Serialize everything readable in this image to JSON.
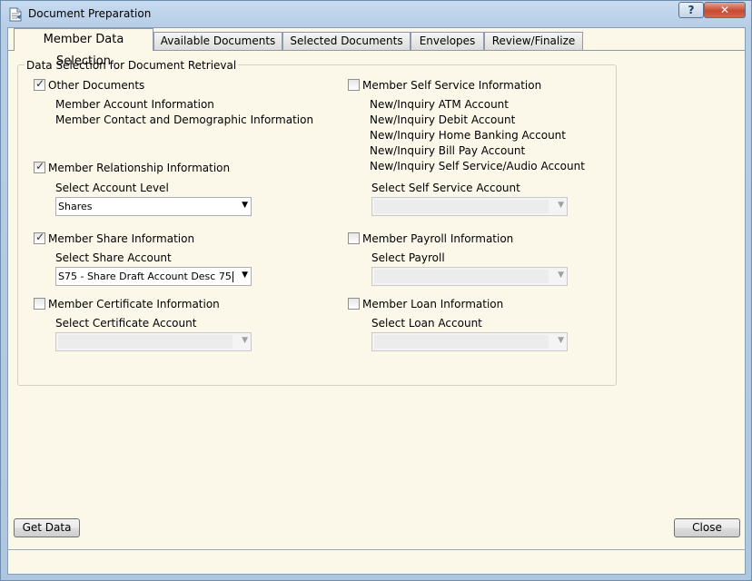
{
  "window": {
    "title": "Document Preparation",
    "help_label": "?",
    "close_label": "✕"
  },
  "tabs": [
    {
      "label": "Member Data Selection"
    },
    {
      "label": "Available Documents"
    },
    {
      "label": "Selected Documents"
    },
    {
      "label": "Envelopes"
    },
    {
      "label": "Review/Finalize"
    }
  ],
  "group": {
    "legend": "Data Selection for Document Retrieval",
    "other_documents": {
      "label": "Other Documents",
      "checked": true,
      "items": [
        "Member Account Information",
        "Member Contact and Demographic Information"
      ]
    },
    "relationship": {
      "label": "Member Relationship Information",
      "checked": true,
      "select_label": "Select Account Level",
      "select_value": "Shares"
    },
    "share": {
      "label": "Member Share Information",
      "checked": true,
      "select_label": "Select Share Account",
      "select_value": "S75 - Share Draft Account Desc 75"
    },
    "certificate": {
      "label": "Member Certificate Information",
      "checked": false,
      "select_label": "Select Certificate Account",
      "select_value": ""
    },
    "self_service": {
      "label": "Member Self Service Information",
      "checked": false,
      "items": [
        "New/Inquiry ATM Account",
        "New/Inquiry Debit Account",
        "New/Inquiry Home Banking Account",
        "New/Inquiry Bill Pay Account",
        "New/Inquiry Self Service/Audio Account"
      ],
      "select_label": "Select Self Service Account",
      "select_value": ""
    },
    "payroll": {
      "label": "Member Payroll Information",
      "checked": false,
      "select_label": "Select Payroll",
      "select_value": ""
    },
    "loan": {
      "label": "Member Loan Information",
      "checked": false,
      "select_label": "Select Loan Account",
      "select_value": ""
    }
  },
  "buttons": {
    "get_data": "Get Data",
    "close": "Close"
  },
  "icons": {
    "check": "✓",
    "dropdown": "▼"
  }
}
